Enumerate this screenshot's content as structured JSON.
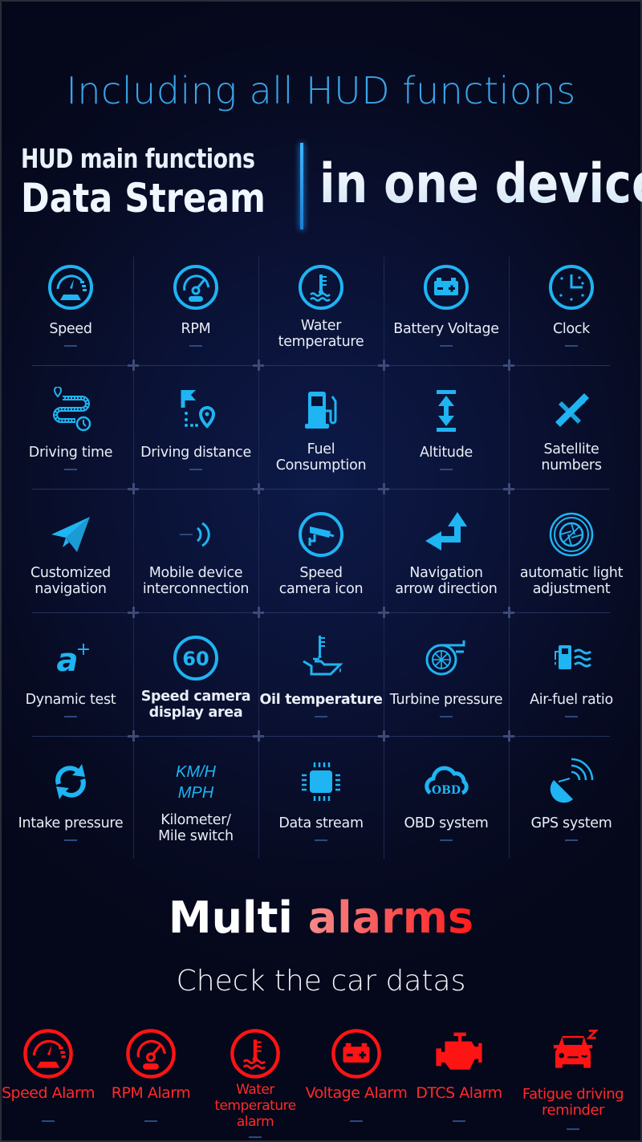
{
  "header": {
    "title": "Including all HUD functions",
    "hero_line1": "HUD main functions",
    "hero_line2": "Data Stream",
    "hero_right": "in one device"
  },
  "colors": {
    "accent_blue": "#1fb4f2",
    "title_blue": "#3aa6e8",
    "alarm_red": "#ff1414",
    "background": "#070b22"
  },
  "features": [
    {
      "label": "Speed",
      "icon": "speedometer-icon"
    },
    {
      "label": "RPM",
      "icon": "tachometer-icon"
    },
    {
      "label": "Water\ntemperature",
      "icon": "coolant-temperature-icon"
    },
    {
      "label": "Battery Voltage",
      "icon": "battery-icon"
    },
    {
      "label": "Clock",
      "icon": "clock-icon"
    },
    {
      "label": "Driving time",
      "icon": "route-timer-icon"
    },
    {
      "label": "Driving distance",
      "icon": "flag-to-pin-icon"
    },
    {
      "label": "Fuel\nConsumption",
      "icon": "fuel-pump-icon"
    },
    {
      "label": "Altitude",
      "icon": "altitude-arrows-icon"
    },
    {
      "label": "Satellite\nnumbers",
      "icon": "satellite-icon"
    },
    {
      "label": "Customized\nnavigation",
      "icon": "paper-plane-icon"
    },
    {
      "label": "Mobile device\ninterconnection",
      "icon": "signal-waves-icon"
    },
    {
      "label": "Speed\ncamera icon",
      "icon": "surveillance-camera-icon"
    },
    {
      "label": "Navigation\narrow direction",
      "icon": "turn-arrow-icon"
    },
    {
      "label": "automatic light\nadjustment",
      "icon": "aperture-icon"
    },
    {
      "label": "Dynamic test",
      "icon": "acceleration-a-plus-icon",
      "glyph": "a",
      "glyph_sup": "+"
    },
    {
      "label": "Speed camera\ndisplay area",
      "icon": "speed-limit-60-icon",
      "glyph": "60"
    },
    {
      "label": "Oil temperature",
      "icon": "oil-can-thermometer-icon"
    },
    {
      "label": "Turbine pressure",
      "icon": "turbocharger-icon"
    },
    {
      "label": "Air-fuel ratio",
      "icon": "fuel-air-waves-icon"
    },
    {
      "label": "Intake pressure",
      "icon": "refresh-arrows-icon"
    },
    {
      "label": "Kilometer/\nMile switch",
      "icon": "kmh-mph-text-icon",
      "glyph": "KM/H",
      "glyph2": "MPH"
    },
    {
      "label": "Data stream",
      "icon": "chip-icon"
    },
    {
      "label": "OBD system",
      "icon": "obd-cloud-icon",
      "glyph": "OBD"
    },
    {
      "label": "GPS system",
      "icon": "satellite-dish-icon"
    }
  ],
  "alarms_section": {
    "title_white": "Multi ",
    "title_red": "alarms",
    "subtitle": "Check the car datas",
    "items": [
      {
        "label": "Speed Alarm",
        "icon": "speedometer-alarm-icon"
      },
      {
        "label": "RPM Alarm",
        "icon": "tachometer-alarm-icon"
      },
      {
        "label": "Water\ntemperature\nalarm",
        "icon": "coolant-alarm-icon"
      },
      {
        "label": "Voltage Alarm",
        "icon": "battery-alarm-icon"
      },
      {
        "label": "DTCS Alarm",
        "icon": "engine-check-icon"
      },
      {
        "label": "Fatigue driving\nreminder",
        "icon": "car-sleep-icon"
      }
    ]
  }
}
